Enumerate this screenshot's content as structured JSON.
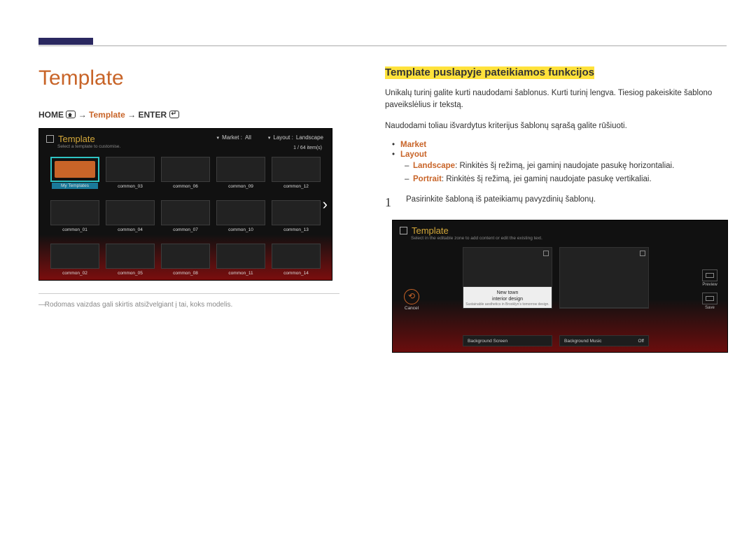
{
  "title": "Template",
  "breadcrumb": {
    "home": "HOME",
    "arrow": "→",
    "template": "Template",
    "enter": "ENTER"
  },
  "screen1": {
    "title": "Template",
    "subtitle": "Select a template to customise.",
    "filters": {
      "market_label": "Market :",
      "market_value": "All",
      "layout_label": "Layout :",
      "layout_value": "Landscape"
    },
    "count": "1 / 64 item(s)",
    "thumbs_selected": "My Templates",
    "thumbs": [
      "common_03",
      "common_06",
      "common_09",
      "common_12",
      "common_01",
      "common_04",
      "common_07",
      "common_10",
      "common_13",
      "common_02",
      "common_05",
      "common_08",
      "common_11",
      "common_14"
    ]
  },
  "note": "Rodomas vaizdas gali skirtis atsižvelgiant į tai, koks modelis.",
  "section_title": "Template puslapyje pateikiamos funkcijos",
  "para1": "Unikalų turinį galite kurti naudodami šablonus. Kurti turinį lengva. Tiesiog pakeiskite šablono paveikslėlius ir tekstą.",
  "para2": "Naudodami toliau išvardytus kriterijus šablonų sąrašą galite rūšiuoti.",
  "bullets": {
    "market": "Market",
    "layout": "Layout",
    "landscape_label": "Landscape",
    "landscape_text": ": Rinkitės šį režimą, jei gaminį naudojate pasukę horizontaliai.",
    "portrait_label": "Portrait",
    "portrait_text": ": Rinkitės šį režimą, jei gaminį naudojate pasukę vertikaliai."
  },
  "step": {
    "num": "1",
    "text": "Pasirinkite šabloną iš pateikiamų pavyzdinių šablonų."
  },
  "screen2": {
    "title": "Template",
    "subtitle": "Select in the editable zone to add content or edit the existing text.",
    "cancel": "Cancel",
    "preview": "Preview",
    "save": "Save",
    "panel1": {
      "title": "New town",
      "subtitle": "interior design",
      "caption": "Sustainable aesthetics in Brooklyn’s tomorrow design."
    },
    "bottom": {
      "bg_screen": "Background Screen",
      "bg_music": "Background Music",
      "off": "Off"
    }
  }
}
